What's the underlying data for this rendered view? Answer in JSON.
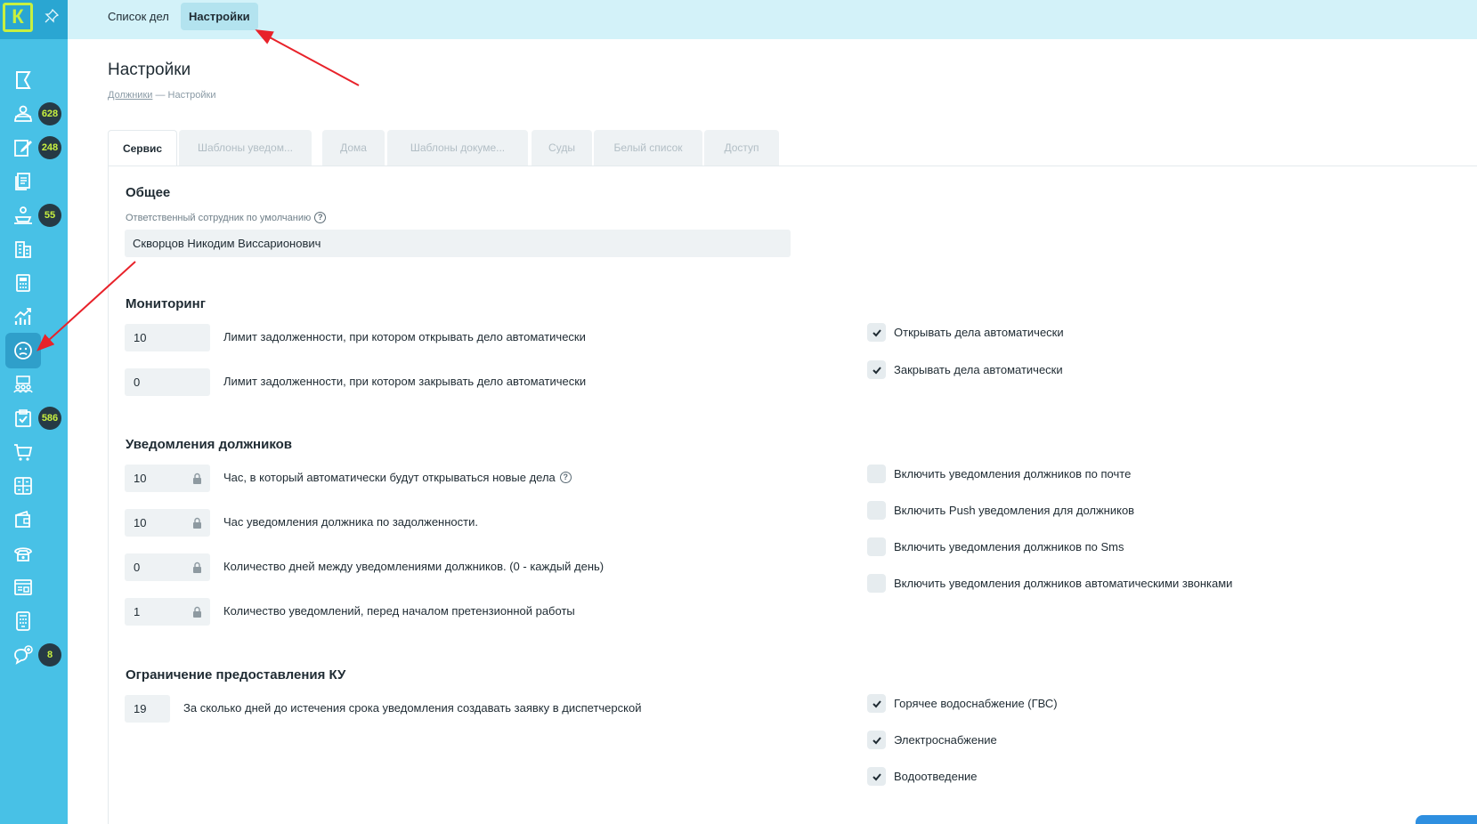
{
  "app": {
    "logo_letter": "К",
    "accent": "#48c1e6",
    "badge_text_color": "#c8f040"
  },
  "sidebar": {
    "items": [
      {
        "icon": "flag-icon",
        "badge": ""
      },
      {
        "icon": "users-group-icon",
        "badge": "628"
      },
      {
        "icon": "edit-document-icon",
        "badge": "248"
      },
      {
        "icon": "documents-icon",
        "badge": ""
      },
      {
        "icon": "court-icon",
        "badge": "55"
      },
      {
        "icon": "building-icon",
        "badge": ""
      },
      {
        "icon": "calculator-icon",
        "badge": ""
      },
      {
        "icon": "chart-growth-icon",
        "badge": ""
      },
      {
        "icon": "sad-face-icon",
        "badge": "",
        "active": true
      },
      {
        "icon": "team-icon",
        "badge": ""
      },
      {
        "icon": "clipboard-check-icon",
        "badge": "586"
      },
      {
        "icon": "cart-icon",
        "badge": ""
      },
      {
        "icon": "grid-table-icon",
        "badge": ""
      },
      {
        "icon": "wallet-icon",
        "badge": ""
      },
      {
        "icon": "phone-icon",
        "badge": ""
      },
      {
        "icon": "browser-window-icon",
        "badge": ""
      },
      {
        "icon": "device-icon",
        "badge": ""
      },
      {
        "icon": "chat-add-icon",
        "badge": "8"
      }
    ]
  },
  "topbar": {
    "tabs": [
      {
        "label": "Список дел",
        "active": false
      },
      {
        "label": "Настройки",
        "active": true
      }
    ]
  },
  "page": {
    "title": "Настройки",
    "breadcrumb_link": "Должники",
    "breadcrumb_sep": " — ",
    "breadcrumb_current": "Настройки"
  },
  "tabs": [
    {
      "label": "Сервис",
      "active": true
    },
    {
      "label": "Шаблоны уведом...",
      "active": false
    },
    {
      "label": "Дома",
      "active": false
    },
    {
      "label": "Шаблоны докуме...",
      "active": false
    },
    {
      "label": "Суды",
      "active": false
    },
    {
      "label": "Белый список",
      "active": false
    },
    {
      "label": "Доступ",
      "active": false
    }
  ],
  "general": {
    "title": "Общее",
    "responsible_label": "Ответственный сотрудник по умолчанию",
    "responsible_value": "Скворцов Никодим Виссарионович"
  },
  "monitoring": {
    "title": "Мониторинг",
    "rows": [
      {
        "value": "10",
        "label": "Лимит задолженности, при котором открывать дело автоматически"
      },
      {
        "value": "0",
        "label": "Лимит задолженности, при котором закрывать дело автоматически"
      }
    ],
    "checks": [
      {
        "label": "Открывать дела автоматически",
        "checked": true
      },
      {
        "label": "Закрывать дела автоматически",
        "checked": true
      }
    ]
  },
  "notifications": {
    "title": "Уведомления должников",
    "rows": [
      {
        "value": "10",
        "label": "Час, в который автоматически будут открываться новые дела",
        "help": true
      },
      {
        "value": "10",
        "label": "Час уведомления должника по задолженности.",
        "help": false
      },
      {
        "value": "0",
        "label": "Количество дней между уведомлениями должников. (0 - каждый день)",
        "help": false
      },
      {
        "value": "1",
        "label": "Количество уведомлений, перед началом претензионной работы",
        "help": false
      }
    ],
    "checks": [
      {
        "label": "Включить уведомления должников по почте",
        "checked": false
      },
      {
        "label": "Включить Push уведомления для должников",
        "checked": false
      },
      {
        "label": "Включить уведомления должников по Sms",
        "checked": false
      },
      {
        "label": "Включить уведомления должников автоматическими звонками",
        "checked": false
      }
    ]
  },
  "restriction": {
    "title": "Ограничение предоставления КУ",
    "row": {
      "value": "19",
      "label": "За сколько дней до истечения срока уведомления создавать заявку в диспетчерской"
    },
    "checks": [
      {
        "label": "Горячее водоснабжение (ГВС)",
        "checked": true
      },
      {
        "label": "Электроснабжение",
        "checked": true
      },
      {
        "label": "Водоотведение",
        "checked": true
      }
    ]
  }
}
